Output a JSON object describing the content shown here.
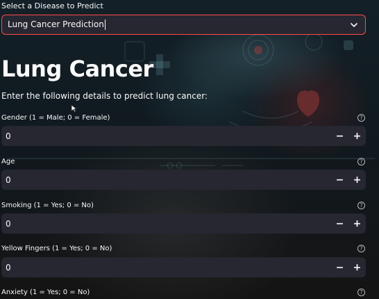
{
  "sidebar_select": {
    "label": "Select a Disease to Predict",
    "value": "Lung Cancer Prediction",
    "accent": "#ff4b4b"
  },
  "page": {
    "title": "Lung Cancer",
    "subtitle": "Enter the following details to predict lung cancer:"
  },
  "fields": [
    {
      "label": "Gender (1 = Male; 0 = Female)",
      "value": "0"
    },
    {
      "label": "Age",
      "value": "0"
    },
    {
      "label": "Smoking (1 = Yes; 0 = No)",
      "value": "0"
    },
    {
      "label": "Yellow Fingers (1 = Yes; 0 = No)",
      "value": "0"
    },
    {
      "label": "Anxiety (1 = Yes; 0 = No)",
      "value": ""
    }
  ],
  "stepper": {
    "minus": "−",
    "plus": "+"
  },
  "help_glyph": "?",
  "icons": [
    "chevron-down-icon",
    "help-circle-icon",
    "minus-icon",
    "plus-icon",
    "mouse-cursor-icon"
  ]
}
